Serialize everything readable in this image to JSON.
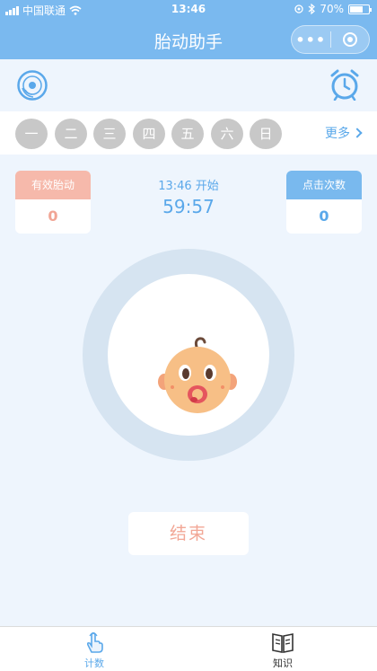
{
  "status_bar": {
    "carrier": "中国联通",
    "time": "13:46",
    "battery": "70%",
    "battery_level": 0.7
  },
  "nav": {
    "title": "胎动助手",
    "more_label": "•••"
  },
  "days": {
    "items": [
      "一",
      "二",
      "三",
      "四",
      "五",
      "六",
      "日"
    ],
    "more_label": "更多"
  },
  "stats": {
    "effective_label": "有效胎动",
    "effective_value": "0",
    "clicks_label": "点击次数",
    "clicks_value": "0",
    "start_text": "13:46 开始",
    "timer": "59:57"
  },
  "actions": {
    "end_label": "结束"
  },
  "tabs": [
    {
      "label": "计数",
      "icon": "hand-pointer-icon",
      "active": true
    },
    {
      "label": "知识",
      "icon": "book-icon",
      "active": false
    }
  ],
  "colors": {
    "primary": "#7ab9ef",
    "accent_blue": "#5aa8ea",
    "accent_pink": "#f6b9ab",
    "ring": "#d6e4f1",
    "day_bubble": "#c8c8c8"
  }
}
